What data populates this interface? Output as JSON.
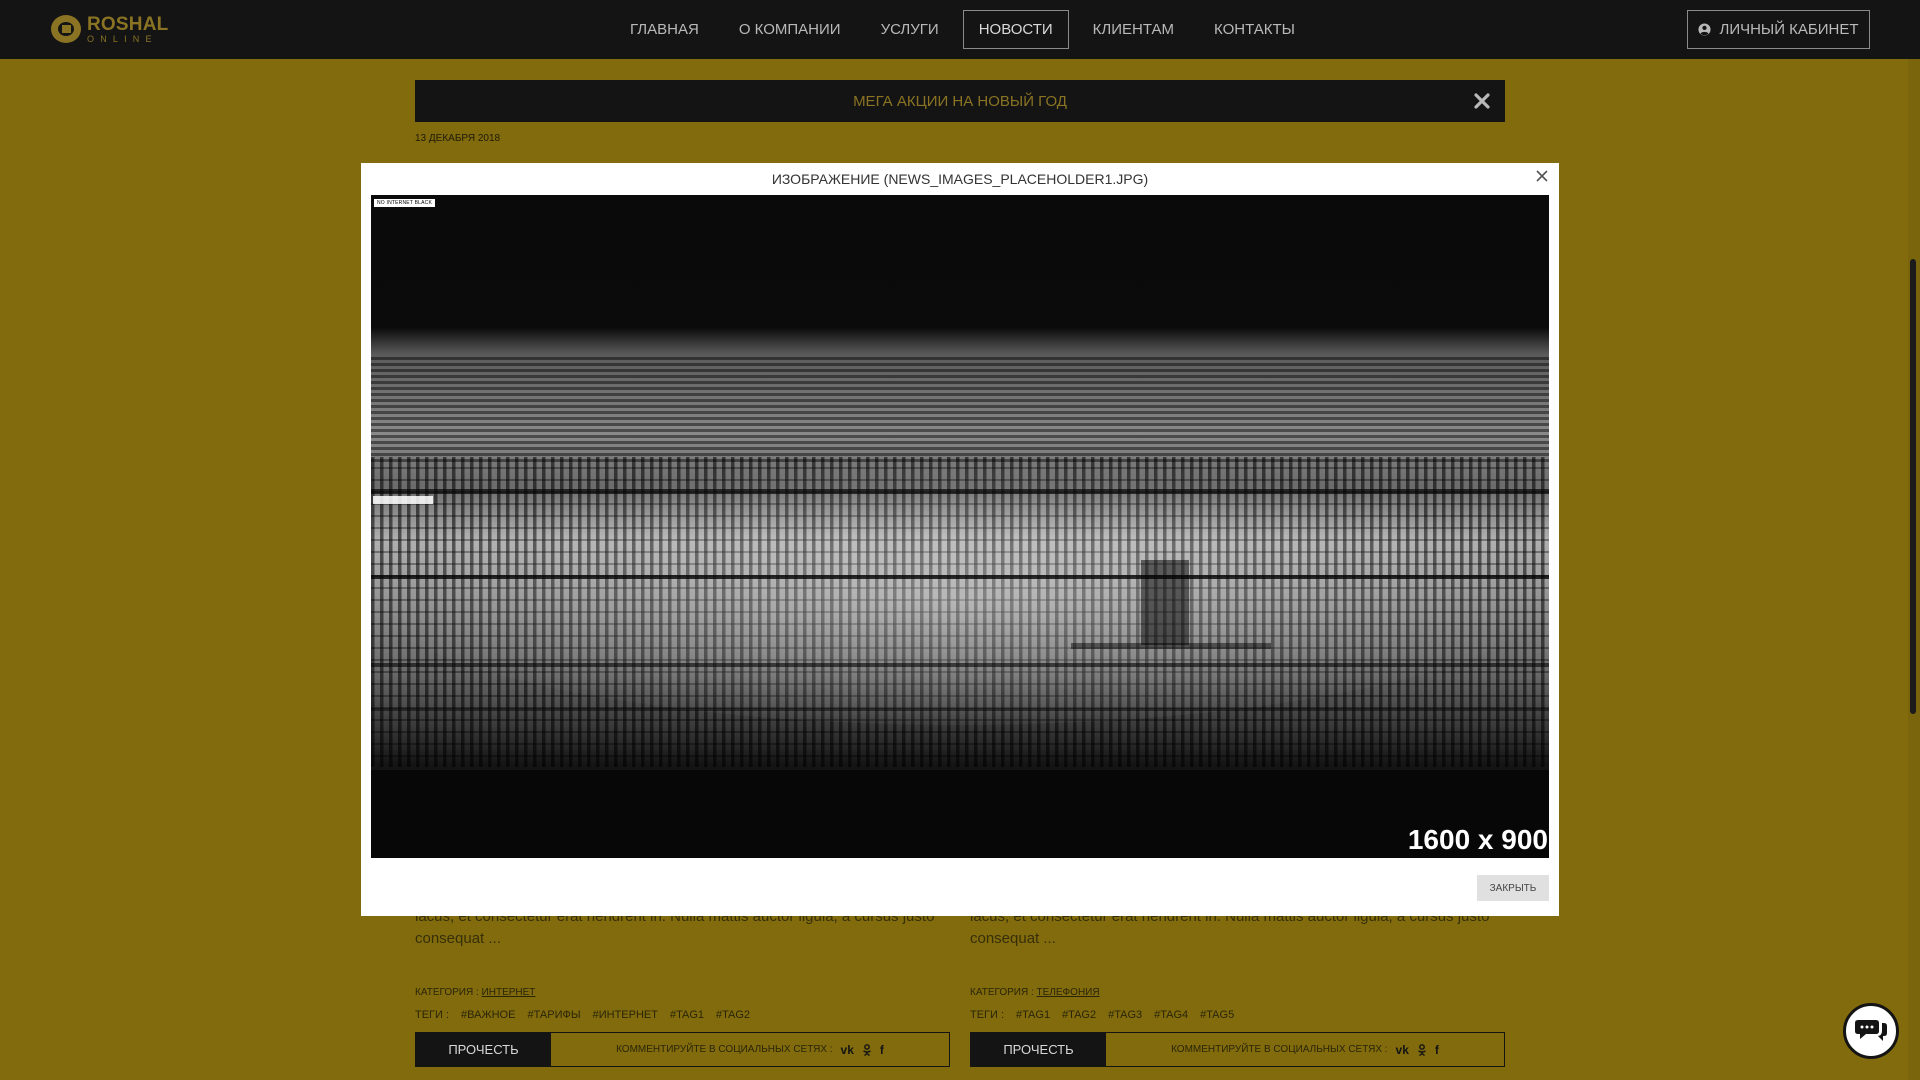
{
  "header": {
    "logo": {
      "name": "ROSHAL",
      "sub": "ONLINE",
      "color": "#8a7423"
    },
    "nav": [
      {
        "label": "ГЛАВНАЯ",
        "active": false
      },
      {
        "label": "О КОМПАНИИ",
        "active": false
      },
      {
        "label": "УСЛУГИ",
        "active": false
      },
      {
        "label": "НОВОСТИ",
        "active": true
      },
      {
        "label": "КЛИЕНТАМ",
        "active": false
      },
      {
        "label": "КОНТАКТЫ",
        "active": false
      }
    ],
    "cabinet": {
      "label": "ЛИЧНЫЙ КАБИНЕТ",
      "icon": "user-icon"
    }
  },
  "promo": {
    "text": "МЕГА АКЦИИ НА НОВЫЙ ГОД",
    "close_icon": "close-icon"
  },
  "news": {
    "date": "13 ДЕКАБРЯ 2018",
    "cards": [
      {
        "excerpt": "lacus, et consectetur erat hendrerit in. Nulla mattis auctor ligula, a cursus justo consequat ...",
        "category_label": "КАТЕГОРИЯ :",
        "category": "ИНТЕРНЕТ",
        "tags_label": "ТЕГИ :",
        "tags": [
          "#ВАЖНОЕ",
          "#ТАРИФЫ",
          "#ИНТЕРНЕТ",
          "#TAG1",
          "#TAG2"
        ],
        "read_label": "ПРОЧЕСТЬ",
        "social_label": "КОММЕНТИРУЙТЕ В СОЦИАЛЬНЫХ СЕТЯХ :"
      },
      {
        "excerpt": "lacus, et consectetur erat hendrerit in. Nulla mattis auctor ligula, a cursus justo consequat ...",
        "category_label": "КАТЕГОРИЯ :",
        "category": "ТЕЛЕФОНИЯ",
        "tags_label": "ТЕГИ :",
        "tags": [
          "#TAG1",
          "#TAG2",
          "#TAG3",
          "#TAG4",
          "#TAG5"
        ],
        "read_label": "ПРОЧЕСТЬ",
        "social_label": "КОММЕНТИРУЙТЕ В СОЦИАЛЬНЫХ СЕТЯХ :"
      }
    ],
    "social_icons": [
      "vk-icon",
      "odnoklassniki-icon",
      "facebook-icon"
    ]
  },
  "modal": {
    "title": "ИЗОБРАЖЕНИЕ (NEWS_IMAGES_PLACEHOLDER1.JPG)",
    "image_caption": "NO INTERNET BLACK",
    "image_size": "1600 x 900",
    "close_label": "ЗАКРЫТЬ"
  },
  "colors": {
    "page_bg": "#816b0c",
    "header_bg": "#141414",
    "accent": "#8a7423"
  }
}
